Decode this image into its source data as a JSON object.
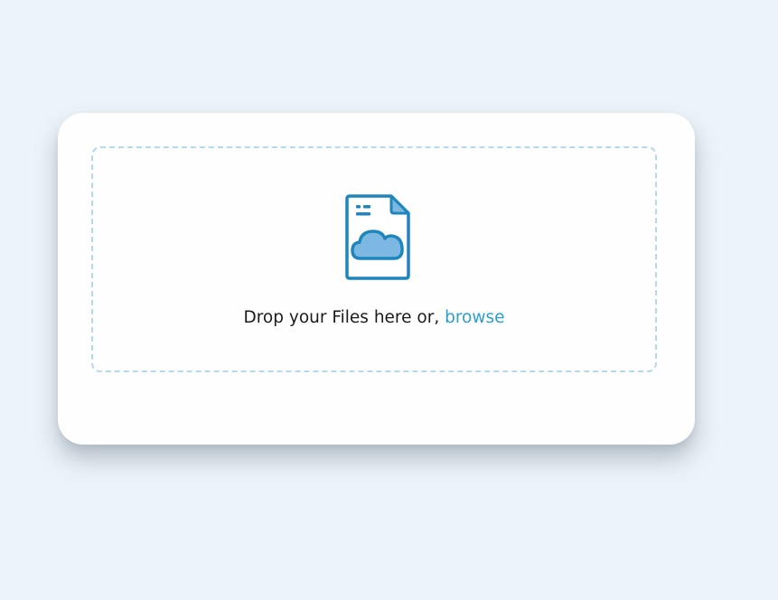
{
  "upload": {
    "prompt_text": "Drop your Files here or, ",
    "browse_label": "browse",
    "icon": "file-cloud-icon"
  },
  "colors": {
    "page_background": "#ebf4f9",
    "card_background": "#fefefe",
    "dashed_border": "#b3d9ec",
    "icon_stroke": "#1f86bd",
    "icon_fill": "#7cb8e2",
    "link": "#2b9fd0",
    "text": "#1b1b1b"
  }
}
